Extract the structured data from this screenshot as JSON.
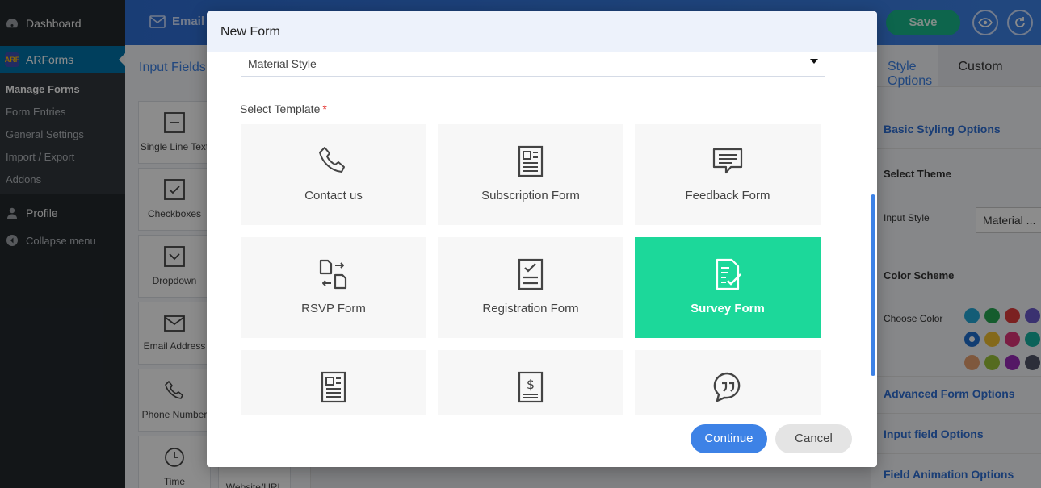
{
  "wp_menu": {
    "dashboard": "Dashboard",
    "arforms": "ARForms",
    "arforms_logo": "ARF",
    "submenu": [
      "Manage Forms",
      "Form Entries",
      "General Settings",
      "Import / Export",
      "Addons"
    ],
    "profile": "Profile",
    "collapse": "Collapse menu"
  },
  "topbar": {
    "email_tab": "Email",
    "save_label": "Save"
  },
  "left_panel": {
    "tab": "Input Fields",
    "fields": [
      "Single Line Text",
      "Checkboxes",
      "Dropdown",
      "Email Address",
      "Phone Number",
      "Time"
    ],
    "fields_col2": [
      "Website/URL"
    ]
  },
  "right_panel": {
    "tab_style": "Style Options",
    "tab_custom": "Custom",
    "basic_styling": "Basic Styling Options",
    "select_theme": "Select Theme",
    "input_style_label": "Input Style",
    "input_style_value": "Material ...",
    "color_scheme": "Color Scheme",
    "choose_color": "Choose Color",
    "advanced": "Advanced Form Options",
    "input_field": "Input field Options",
    "animation": "Field Animation Options",
    "colors": [
      "#23a8d8",
      "#27a853",
      "#e03c3c",
      "#6a5acd",
      "#1f6fd0",
      "#f0c030",
      "#e0357a",
      "#17b3a3",
      "#e8a070",
      "#9cc33a",
      "#9a2ab8",
      "#505468"
    ]
  },
  "modal": {
    "title": "New Form",
    "style_value": "Material Style",
    "select_template_label": "Select Template",
    "required_mark": "*",
    "templates": [
      {
        "label": "Contact us",
        "icon": "phone-icon"
      },
      {
        "label": "Subscription Form",
        "icon": "newspaper-icon"
      },
      {
        "label": "Feedback Form",
        "icon": "comment-icon"
      },
      {
        "label": "RSVP Form",
        "icon": "rsvp-icon"
      },
      {
        "label": "Registration Form",
        "icon": "checklist-icon"
      },
      {
        "label": "Survey Form",
        "icon": "survey-icon",
        "selected": true
      },
      {
        "label": "",
        "icon": "document-icon"
      },
      {
        "label": "",
        "icon": "invoice-icon"
      },
      {
        "label": "",
        "icon": "quote-icon"
      }
    ],
    "continue_label": "Continue",
    "cancel_label": "Cancel"
  }
}
